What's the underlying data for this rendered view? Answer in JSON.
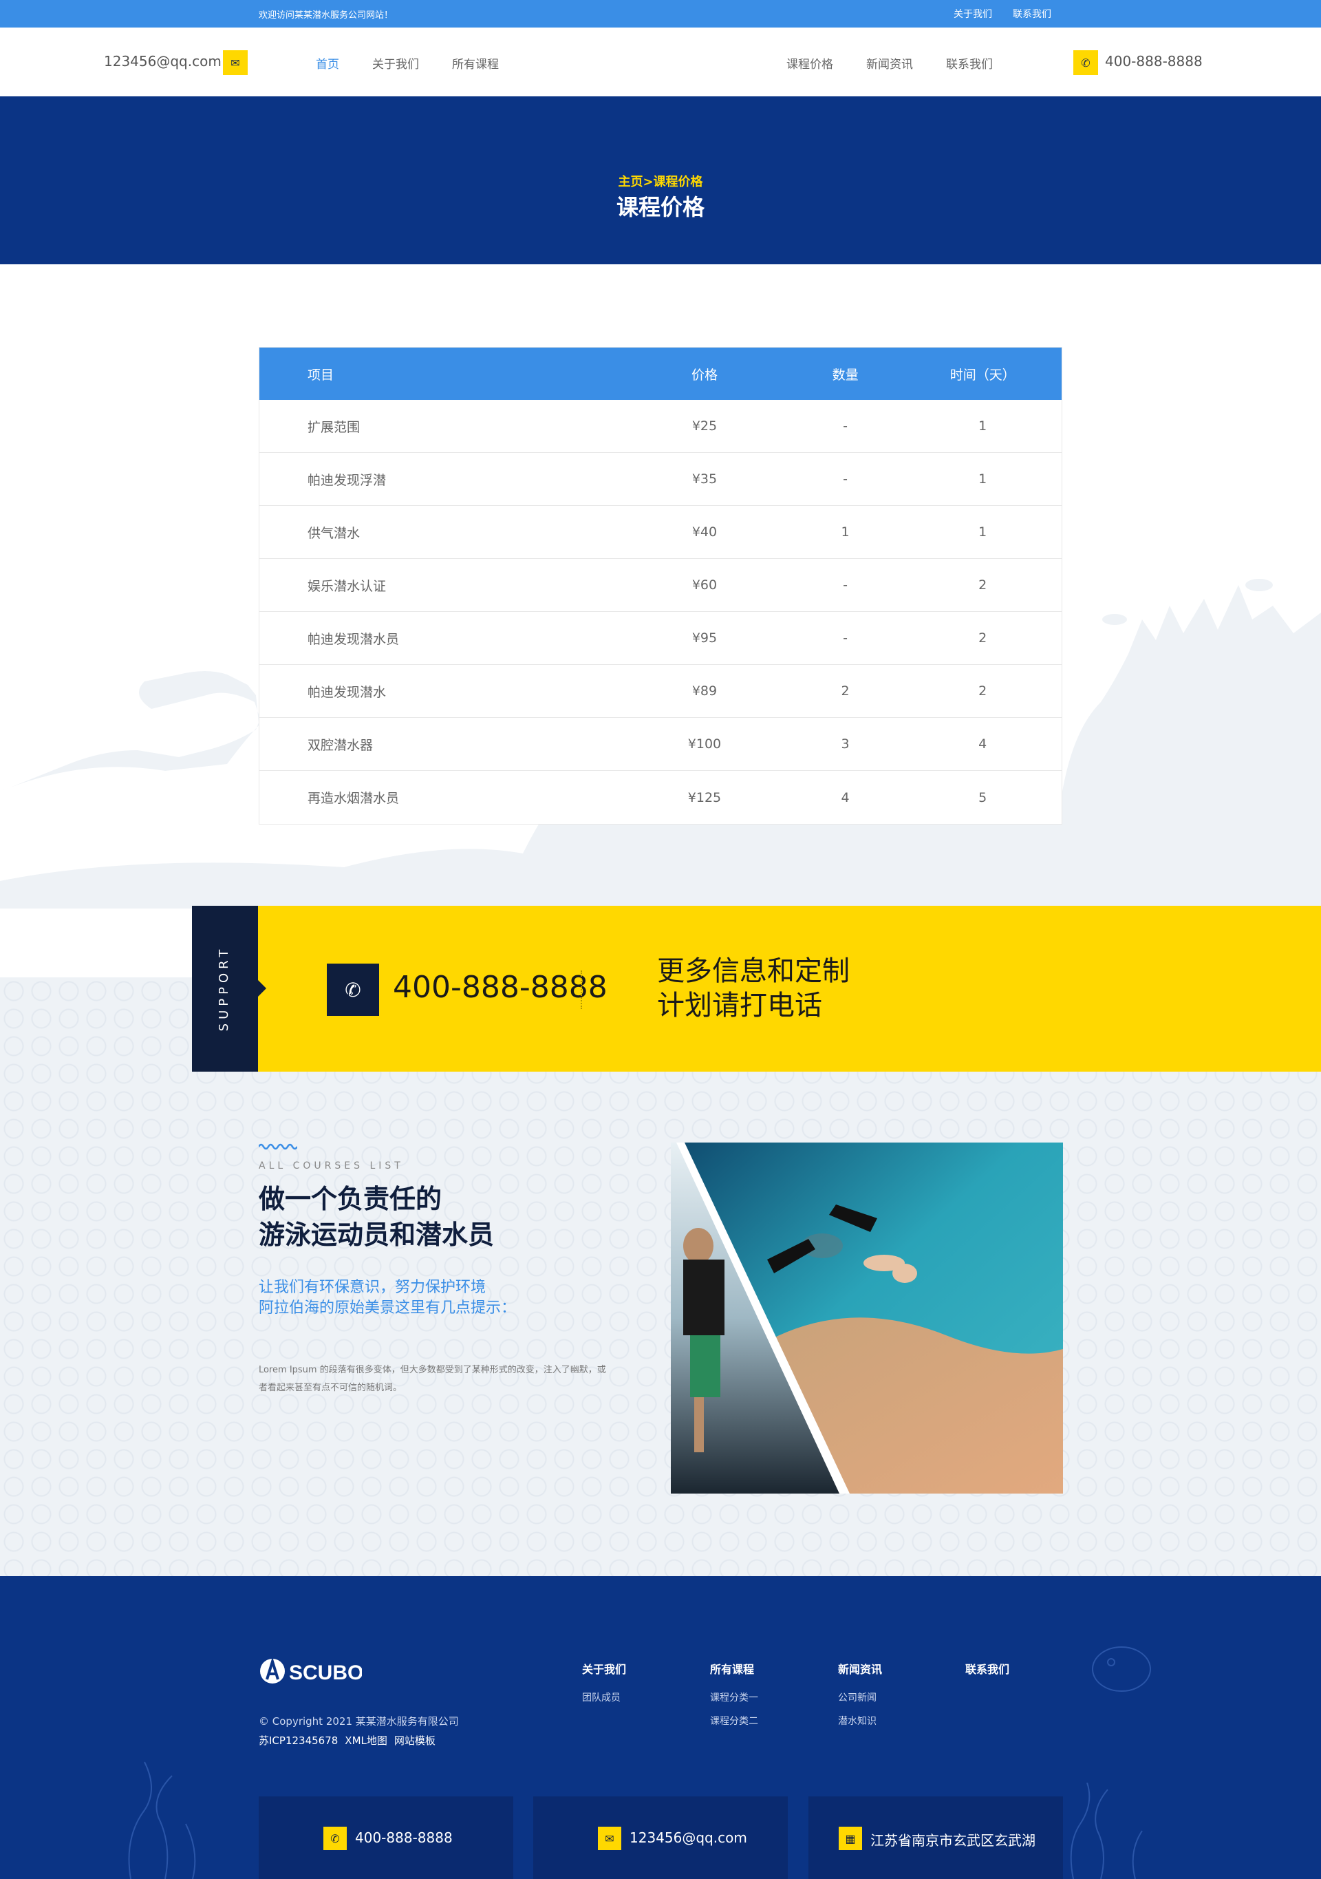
{
  "topbar": {
    "welcome": "欢迎访问某某潜水服务公司网站！",
    "links": [
      "关于我们",
      "联系我们"
    ]
  },
  "header": {
    "email": "123456@qq.com",
    "phone": "400-888-8888",
    "nav_left": [
      "首页",
      "关于我们",
      "所有课程"
    ],
    "nav_right": [
      "课程价格",
      "新闻资讯",
      "联系我们"
    ]
  },
  "banner": {
    "crumb": "主页>课程价格",
    "title": "课程价格"
  },
  "table": {
    "headers": [
      "项目",
      "价格",
      "数量",
      "时间（天）"
    ],
    "rows": [
      [
        "扩展范围",
        "¥25",
        "-",
        "1"
      ],
      [
        "帕迪发现浮潜",
        "¥35",
        "-",
        "1"
      ],
      [
        "供气潜水",
        "¥40",
        "1",
        "1"
      ],
      [
        "娱乐潜水认证",
        "¥60",
        "-",
        "2"
      ],
      [
        "帕迪发现潜水员",
        "¥95",
        "-",
        "2"
      ],
      [
        "帕迪发现潜水",
        "¥89",
        "2",
        "2"
      ],
      [
        "双腔潜水器",
        "¥100",
        "3",
        "4"
      ],
      [
        "再造水烟潜水员",
        "¥125",
        "4",
        "5"
      ]
    ]
  },
  "support": {
    "tab": "SUPPORT",
    "phone": "400-888-8888",
    "msg_line1": "更多信息和定制",
    "msg_line2": "计划请打电话"
  },
  "courses": {
    "sub_en": "ALL COURSES LIST",
    "title_line1": "做一个负责任的",
    "title_line2": "游泳运动员和潜水员",
    "sub_line1": "让我们有环保意识，努力保护环境",
    "sub_line2": "阿拉伯海的原始美景这里有几点提示：",
    "desc": "Lorem Ipsum 的段落有很多变体，但大多数都受到了某种形式的改变，注入了幽默，或者看起来甚至有点不可信的随机词。"
  },
  "footer": {
    "logo": "SCUBO",
    "copyright": "© Copyright 2021 某某潜水服务有限公司",
    "icp": [
      "苏ICP12345678",
      "XML地图",
      "网站模板"
    ],
    "cols": [
      {
        "title": "关于我们",
        "items": [
          "团队成员"
        ]
      },
      {
        "title": "所有课程",
        "items": [
          "课程分类一",
          "课程分类二"
        ]
      },
      {
        "title": "新闻资讯",
        "items": [
          "公司新闻",
          "潜水知识"
        ]
      },
      {
        "title": "联系我们",
        "items": []
      }
    ],
    "contacts": {
      "phone": "400-888-8888",
      "email": "123456@qq.com",
      "address": "江苏省南京市玄武区玄武湖"
    }
  },
  "icons": {
    "email": "envelope-icon",
    "phone": "phone-icon",
    "map": "map-icon"
  },
  "colors": {
    "accent": "#3a8ee6",
    "yellow": "#ffd800",
    "navy": "#0b3485"
  }
}
